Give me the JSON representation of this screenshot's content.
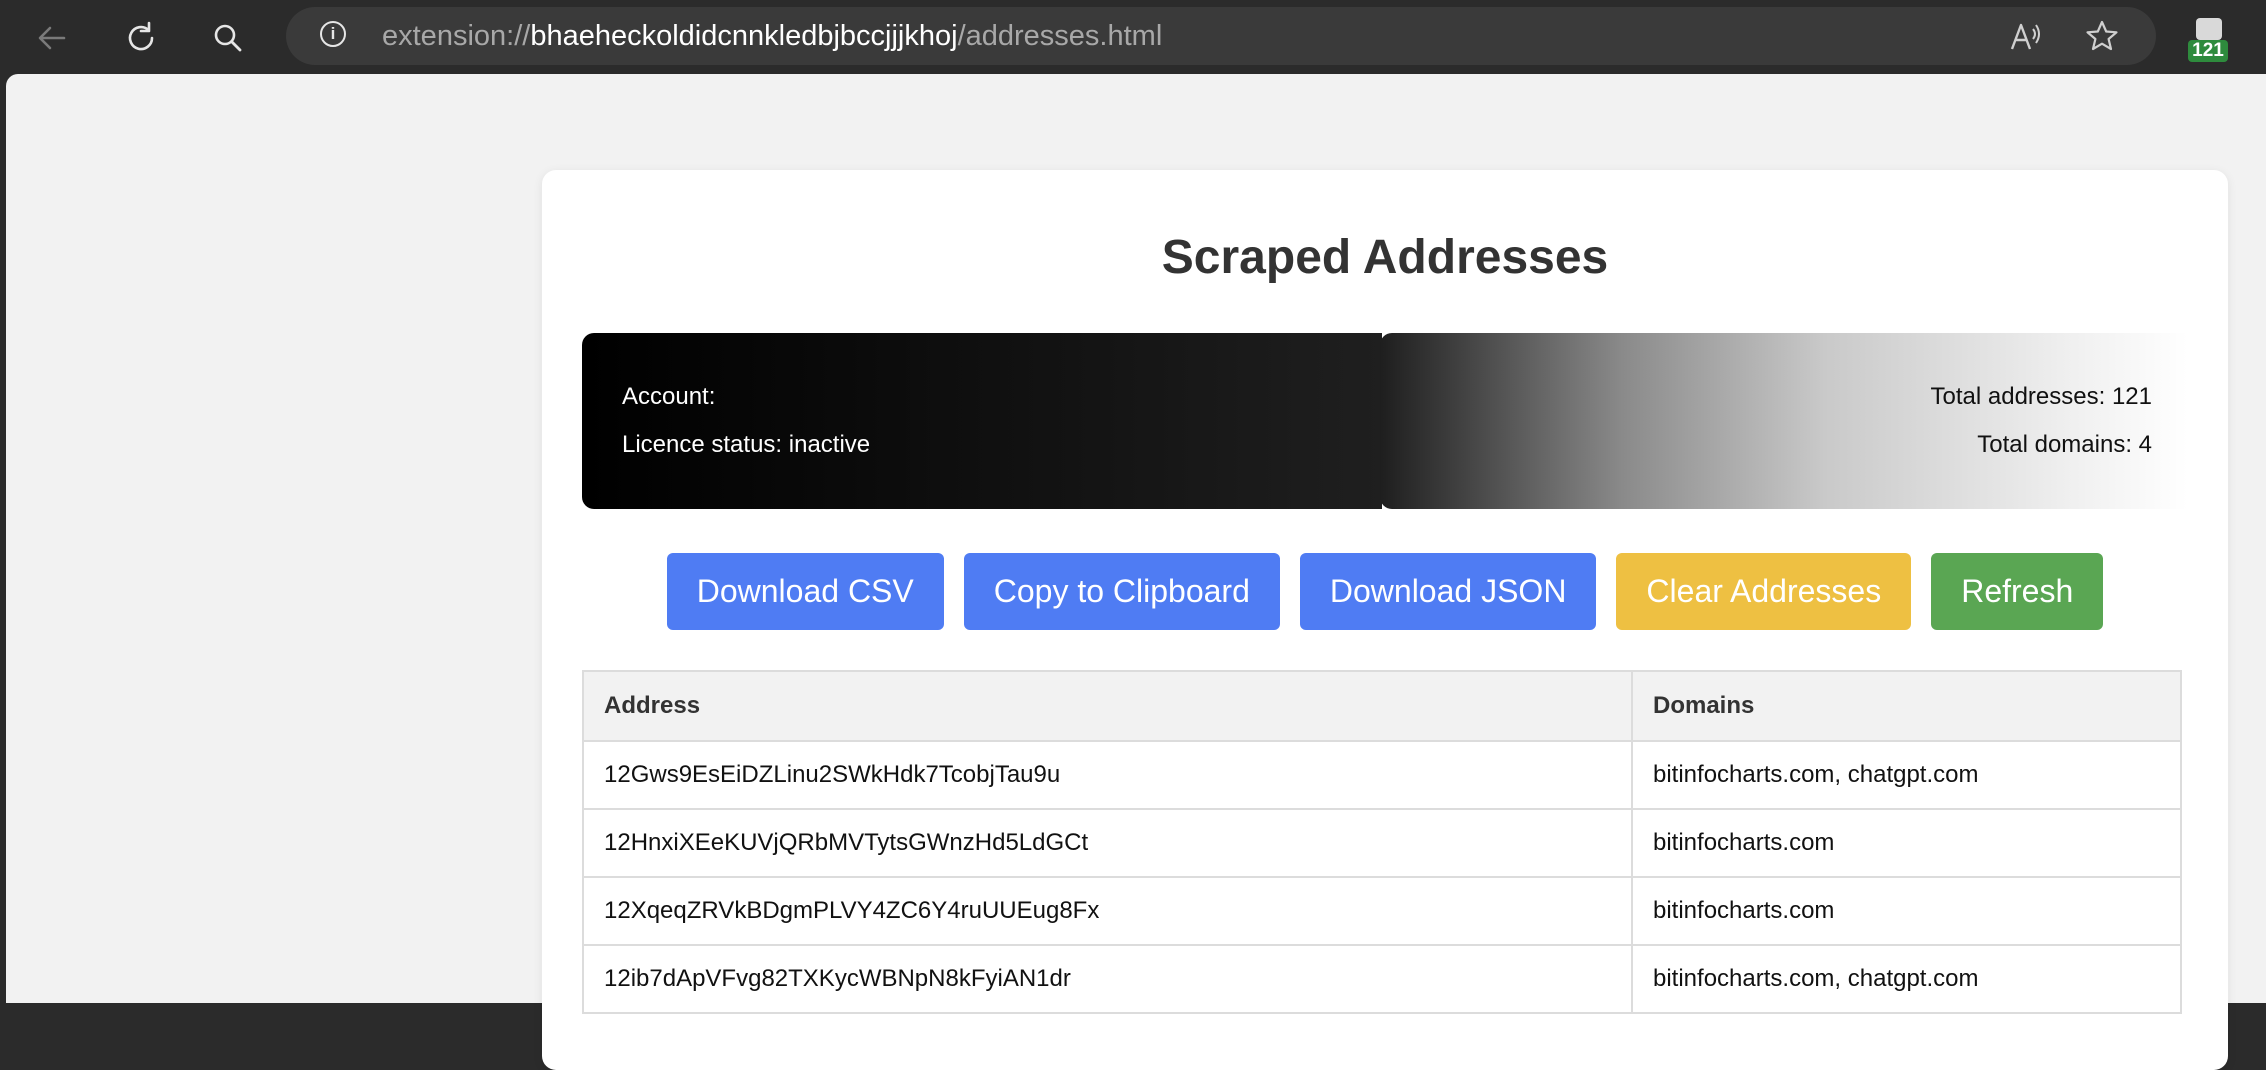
{
  "browser": {
    "url_scheme": "extension://",
    "url_host": "bhaeheckoldidcnnkledbjbccjjjkhoj",
    "url_path": "/addresses.html",
    "extension_badge": "121",
    "icons": {
      "back": "back-arrow-icon",
      "reload": "reload-icon",
      "search": "search-icon",
      "site_info": "info-icon",
      "read_aloud": "read-aloud-icon",
      "favorite": "star-icon",
      "extension": "extension-icon"
    }
  },
  "page": {
    "title": "Scraped Addresses",
    "account_label": "Account:",
    "licence_status": "Licence status: inactive",
    "total_addresses": "Total addresses: 121",
    "total_domains": "Total domains: 4"
  },
  "actions": {
    "download_csv": "Download CSV",
    "copy_clipboard": "Copy to Clipboard",
    "download_json": "Download JSON",
    "clear_addresses": "Clear Addresses",
    "refresh": "Refresh"
  },
  "colors": {
    "primary_button": "#4f7cf3",
    "warning_button": "#eec042",
    "success_button": "#5aa653",
    "badge": "#2e8b3d"
  },
  "table": {
    "headers": [
      "Address",
      "Domains"
    ],
    "rows": [
      [
        "12Gws9EsEiDZLinu2SWkHdk7TcobjTau9u",
        "bitinfocharts.com, chatgpt.com"
      ],
      [
        "12HnxiXEeKUVjQRbMVTytsGWnzHd5LdGCt",
        "bitinfocharts.com"
      ],
      [
        "12XqeqZRVkBDgmPLVY4ZC6Y4ruUUEug8Fx",
        "bitinfocharts.com"
      ],
      [
        "12ib7dApVFvg82TXKycWBNpN8kFyiAN1dr",
        "bitinfocharts.com, chatgpt.com"
      ]
    ]
  }
}
